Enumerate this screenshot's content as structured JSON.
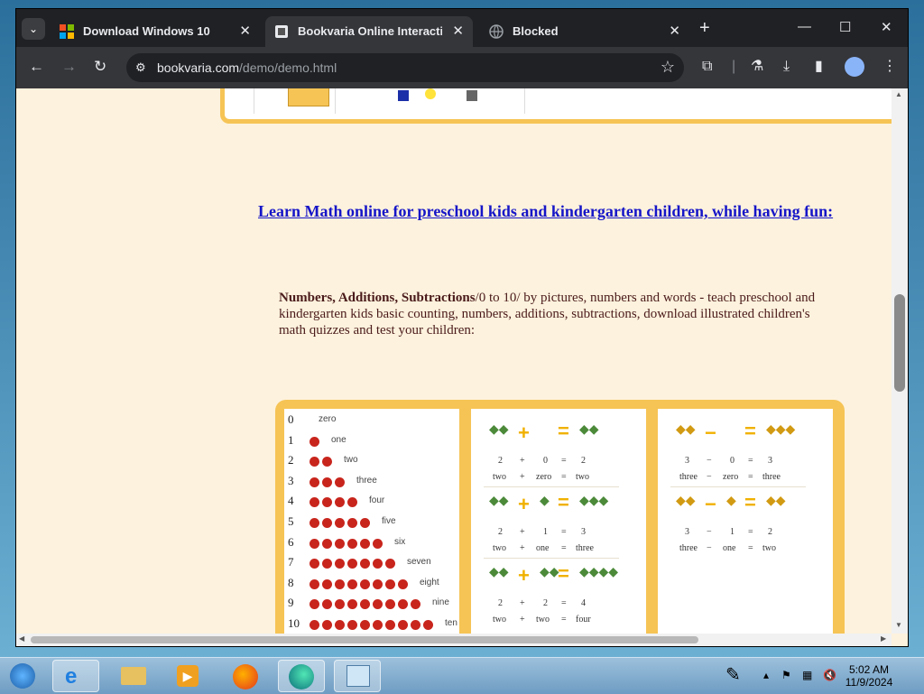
{
  "browser": {
    "tabs": [
      {
        "title": "Download Windows 10",
        "icon": "windows-logo-icon",
        "active": false
      },
      {
        "title": "Bookvaria Online Interactive Le",
        "icon": "bookvaria-icon",
        "active": true
      },
      {
        "title": "Blocked",
        "icon": "globe-icon",
        "active": false
      }
    ],
    "url_host": "bookvaria.com",
    "url_path": "/demo/demo.html"
  },
  "page": {
    "heading": "Learn Math online for preschool kids and kindergarten children, while having fun:",
    "para_bold": "Numbers, Additions, Subtractions",
    "para_rest": "/0 to 10/ by pictures, numbers and words - teach preschool and kindergarten kids basic counting,  numbers, additions, subtractions, download illustrated children's math quizzes and test your children:",
    "numbers": [
      {
        "n": "0",
        "word": "zero",
        "apples": 0
      },
      {
        "n": "1",
        "word": "one",
        "apples": 1
      },
      {
        "n": "2",
        "word": "two",
        "apples": 2
      },
      {
        "n": "3",
        "word": "three",
        "apples": 3
      },
      {
        "n": "4",
        "word": "four",
        "apples": 4
      },
      {
        "n": "5",
        "word": "five",
        "apples": 5
      },
      {
        "n": "6",
        "word": "six",
        "apples": 6
      },
      {
        "n": "7",
        "word": "seven",
        "apples": 7
      },
      {
        "n": "8",
        "word": "eight",
        "apples": 8
      },
      {
        "n": "9",
        "word": "nine",
        "apples": 9
      },
      {
        "n": "10",
        "word": "ten",
        "apples": 10
      }
    ],
    "additions": [
      {
        "a": "2",
        "b": "0",
        "r": "2",
        "aw": "two",
        "bw": "zero",
        "rw": "two"
      },
      {
        "a": "2",
        "b": "1",
        "r": "3",
        "aw": "two",
        "bw": "one",
        "rw": "three"
      },
      {
        "a": "2",
        "b": "2",
        "r": "4",
        "aw": "two",
        "bw": "two",
        "rw": "four"
      }
    ],
    "subtractions": [
      {
        "a": "3",
        "b": "0",
        "r": "3",
        "aw": "three",
        "bw": "zero",
        "rw": "three"
      },
      {
        "a": "3",
        "b": "1",
        "r": "2",
        "aw": "three",
        "bw": "one",
        "rw": "two"
      }
    ],
    "ops": {
      "plus": "+",
      "minus": "−",
      "equals": "=",
      "plus_symbol": "+",
      "minus_symbol": "−"
    }
  },
  "taskbar": {
    "time": "5:02 AM",
    "date": "11/9/2024"
  },
  "colors": {
    "accent_panel": "#f6c455",
    "link": "#1515c8",
    "page_bg": "#fdf2dd"
  }
}
